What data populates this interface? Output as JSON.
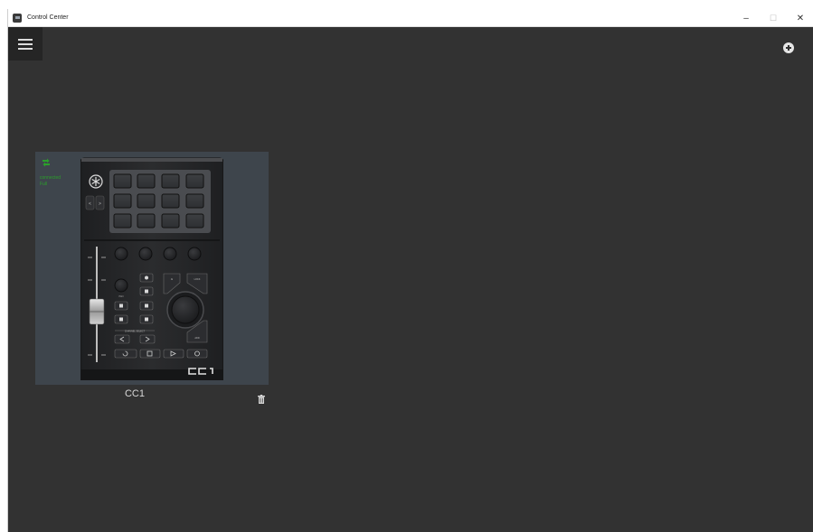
{
  "window": {
    "title": "Control Center",
    "minimize_glyph": "–",
    "maximize_glyph": "☐",
    "close_glyph": "✕"
  },
  "toolbar": {
    "menu_icon": "hamburger-menu-icon",
    "add_icon": "add-circle-icon"
  },
  "devices": [
    {
      "name": "CC1",
      "status_lines": [
        "connected",
        "Full"
      ],
      "status_color": "#2aa02a",
      "link_icon": "link-arrows-icon",
      "delete_icon": "trash-icon",
      "logo": "CC1"
    }
  ],
  "colors": {
    "background": "#323232",
    "card": "#3e454c",
    "accent_green": "#2aa02a"
  }
}
